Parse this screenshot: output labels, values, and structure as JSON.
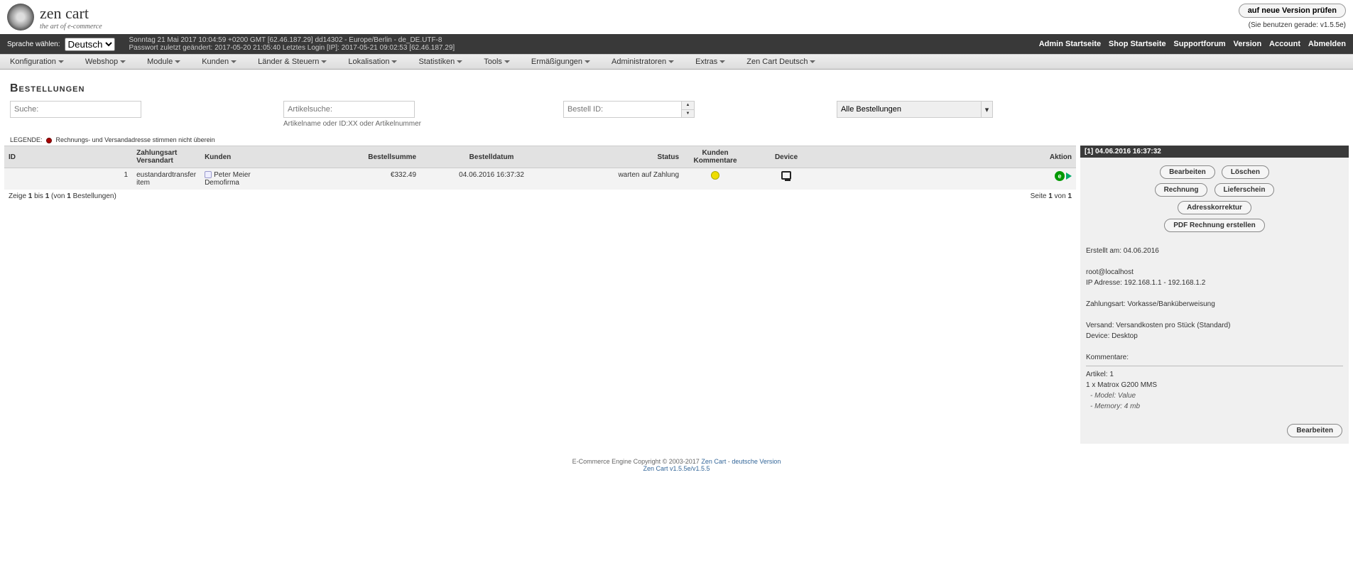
{
  "logo": {
    "title": "zen cart",
    "tagline": "the art of e-commerce"
  },
  "version": {
    "btn": "auf neue Version prüfen",
    "note": "(Sie benutzen gerade: v1.5.5e)"
  },
  "infobar": {
    "lang_label": "Sprache wählen:",
    "lang_value": "Deutsch",
    "date": "Sonntag 21 Mai 2017 10:04:59 +0200 GMT [62.46.187.29]   dd14302 - Europe/Berlin - de_DE.UTF-8",
    "pw": "Passwort zuletzt geändert: 2017-05-20 21:05:40   Letztes Login [IP]: 2017-05-21 09:02:53 [62.46.187.29]"
  },
  "adminnav": [
    "Admin Startseite",
    "Shop Startseite",
    "Supportforum",
    "Version",
    "Account",
    "Abmelden"
  ],
  "menu": [
    "Konfiguration",
    "Webshop",
    "Module",
    "Kunden",
    "Länder & Steuern",
    "Lokalisation",
    "Statistiken",
    "Tools",
    "Ermäßigungen",
    "Administratoren",
    "Extras",
    "Zen Cart Deutsch"
  ],
  "page_title": "Bestellungen",
  "filters": {
    "search_ph": "Suche:",
    "article_ph": "Artikelsuche:",
    "article_hint": "Artikelname oder ID:XX oder Artikelnummer",
    "orderid_ph": "Bestell ID:",
    "status_value": "Alle Bestellungen"
  },
  "legende": {
    "label": "LEGENDE:",
    "text": "Rechnungs- und Versandadresse stimmen nicht überein"
  },
  "table": {
    "cols": {
      "id": "ID",
      "pay": "Zahlungsart Versandart",
      "cust": "Kunden",
      "sum": "Bestellsumme",
      "date": "Bestelldatum",
      "status": "Status",
      "comments": "Kunden Kommentare",
      "device": "Device",
      "action": "Aktion"
    },
    "row": {
      "id": "1",
      "pay": "eustandardtransfer item",
      "cust_name": "Peter Meier",
      "cust_company": "Demofirma",
      "sum": "€332.49",
      "date": "04.06.2016 16:37:32",
      "status": "warten auf Zahlung"
    },
    "pager_left_a": "Zeige ",
    "pager_left_b": "1",
    "pager_left_c": " bis ",
    "pager_left_d": "1",
    "pager_left_e": " (von ",
    "pager_left_f": "1",
    "pager_left_g": " Bestellungen)",
    "pager_right_a": "Seite ",
    "pager_right_b": "1",
    "pager_right_c": " von ",
    "pager_right_d": "1"
  },
  "side": {
    "head": "[1]  04.06.2016 16:37:32",
    "btns": [
      "Bearbeiten",
      "Löschen",
      "Rechnung",
      "Lieferschein",
      "Adresskorrektur",
      "PDF Rechnung erstellen"
    ],
    "created": "Erstellt am: 04.06.2016",
    "email": "root@localhost",
    "ip": "IP Adresse: 192.168.1.1 - 192.168.1.2",
    "pay": "Zahlungsart: Vorkasse/Banküberweisung",
    "ship": "Versand: Versandkosten pro Stück (Standard)",
    "device": "Device: Desktop",
    "comments": "Kommentare:",
    "art_label": "Artikel: 1",
    "art_line": "1 x Matrox G200 MMS",
    "attr1": "- Model: Value",
    "attr2": "- Memory: 4 mb",
    "foot_btn": "Bearbeiten"
  },
  "footer": {
    "line1a": "E-Commerce Engine Copyright © 2003-2017 ",
    "link1": "Zen Cart",
    "line1b": " - ",
    "link2": "deutsche Version",
    "line2": "Zen Cart v1.5.5e/v1.5.5"
  }
}
